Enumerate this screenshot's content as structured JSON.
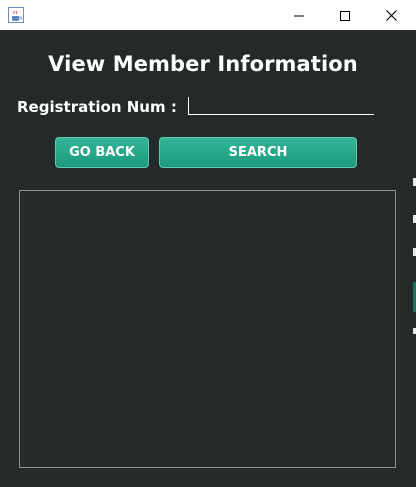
{
  "window": {
    "icons": {
      "app": "java-cup-icon",
      "minimize": "minimize-icon",
      "maximize": "maximize-icon",
      "close": "close-icon"
    }
  },
  "form": {
    "title": "View Member Information",
    "registration_label": "Registration Num :",
    "registration_value": "",
    "go_back_label": "GO BACK",
    "search_label": "SEARCH"
  },
  "colors": {
    "panel_background": "#232a29",
    "button_accent": "#26a88b",
    "text": "#ffffff"
  }
}
